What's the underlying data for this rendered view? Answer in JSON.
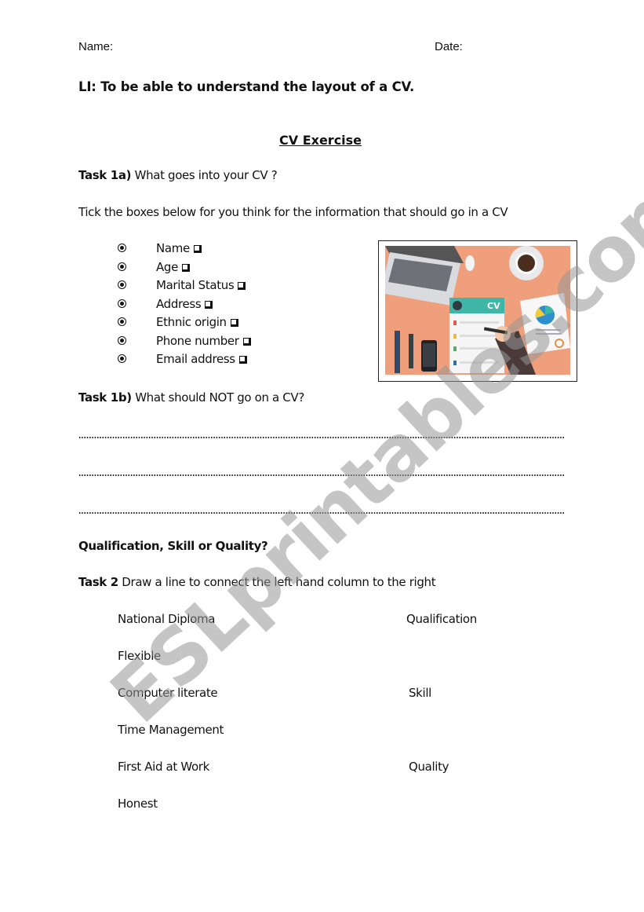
{
  "header": {
    "name_label": "Name:",
    "date_label": "Date:"
  },
  "learning_intention": "LI:  To be able to understand the layout of a CV.",
  "title": "CV Exercise",
  "task1a": {
    "label": "Task 1a)",
    "question": " What goes into your CV ?",
    "instruction": "Tick the boxes below for you think for the information that should go in a CV",
    "items": [
      {
        "label": "Name",
        "checked": false
      },
      {
        "label": "Age",
        "checked": false
      },
      {
        "label": "Marital Status",
        "checked": false
      },
      {
        "label": "Address",
        "checked": false
      },
      {
        "label": "Ethnic origin",
        "checked": false
      },
      {
        "label": "Phone number",
        "checked": false
      },
      {
        "label": "Email address",
        "checked": false
      }
    ],
    "image_alt": "desk-with-cv-illustration"
  },
  "task1b": {
    "label": "Task 1b)",
    "question": " What should NOT go on a CV?",
    "answer_lines": 3
  },
  "section2_heading": "Qualification, Skill or Quality?",
  "task2": {
    "label": "Task 2",
    "instruction": " Draw a line to connect the left hand column to the right",
    "left_column": [
      "National Diploma",
      "Flexible",
      "Computer literate",
      "Time Management",
      "First Aid at Work",
      "Honest"
    ],
    "right_column": [
      "Qualification",
      "Skill",
      "Quality"
    ]
  },
  "watermark": "ESLprintables.com",
  "colors": {
    "illustration_background": "#ef9f7c",
    "watermark": "#969696"
  }
}
